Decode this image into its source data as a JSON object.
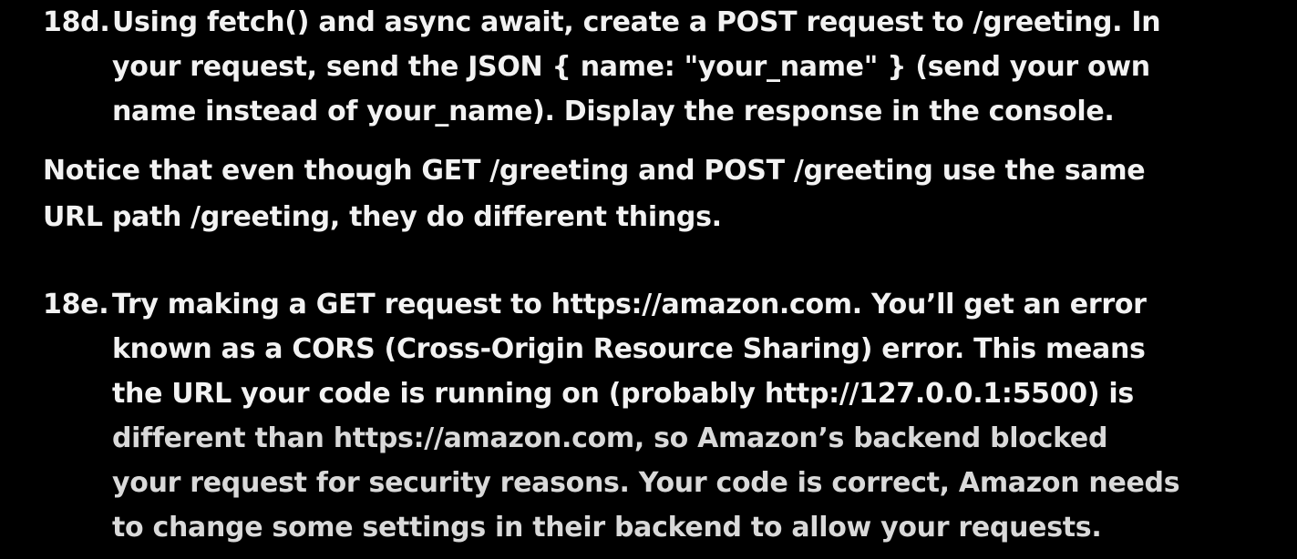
{
  "item_18d": {
    "number": "18d.",
    "lines": [
      "Using fetch() and async await, create a POST request to /greeting. In",
      "your request, send the JSON { name: \"your_name\" } (send your own",
      "name instead of your_name). Display the response in the console."
    ]
  },
  "note": {
    "lines": [
      "Notice that even though GET /greeting and POST /greeting use the same",
      "URL path /greeting, they do different things."
    ]
  },
  "item_18e": {
    "number": "18e.",
    "lines": [
      "Try making a GET request to https://amazon.com. You’ll get an error",
      "known as a CORS (Cross-Origin Resource Sharing) error. This means",
      "the URL your code is running on (probably http://127.0.0.1:5500) is",
      "different than https://amazon.com, so Amazon’s backend blocked",
      "your request for security reasons. Your code is correct, Amazon needs",
      "to change some settings in their backend to allow your requests."
    ]
  }
}
